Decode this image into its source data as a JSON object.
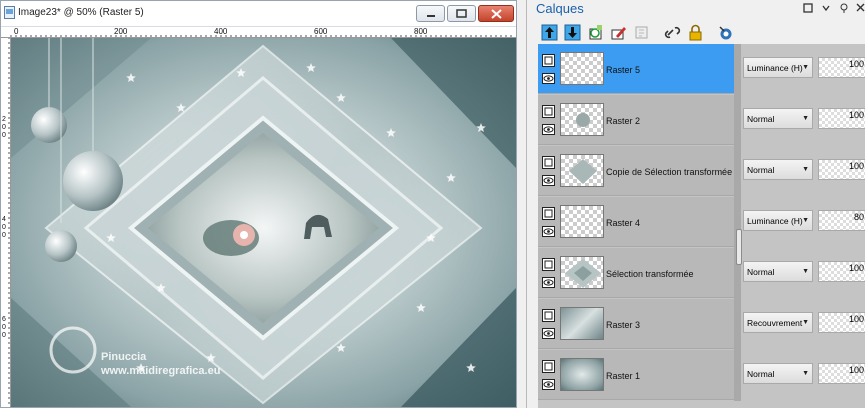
{
  "window": {
    "title": "Image23* @  50% (Raster 5)",
    "controls": {
      "minimize": "minimize",
      "maximize": "maximize",
      "close": "close"
    }
  },
  "ruler": {
    "top_labels": [
      "0",
      "200",
      "400",
      "600",
      "800"
    ],
    "left_labels": [
      "2",
      "0",
      "0",
      "4",
      "0",
      "0",
      "6",
      "0",
      "0"
    ]
  },
  "canvas": {
    "watermark_line1": "Pinuccia",
    "watermark_line2": "www.maidiregrafica.eu"
  },
  "panel": {
    "title": "Calques",
    "toolbar_icons": [
      "move-layer-up-icon",
      "move-layer-down-icon",
      "new-layer-icon",
      "edit-layer-icon",
      "properties-icon",
      "link-icon",
      "lock-icon",
      "mask-icon"
    ],
    "layers": [
      {
        "name": "Raster 5",
        "blend": "Luminance (H)",
        "opacity": "100",
        "selected": true
      },
      {
        "name": "Raster 2",
        "blend": "Normal",
        "opacity": "100",
        "selected": false
      },
      {
        "name": "Copie de Sélection transformée",
        "blend": "Normal",
        "opacity": "100",
        "selected": false
      },
      {
        "name": "Raster 4",
        "blend": "Luminance (H)",
        "opacity": "80",
        "selected": false
      },
      {
        "name": "Sélection transformée",
        "blend": "Normal",
        "opacity": "100",
        "selected": false
      },
      {
        "name": "Raster 3",
        "blend": "Recouvrement",
        "opacity": "100",
        "selected": false
      },
      {
        "name": "Raster 1",
        "blend": "Normal",
        "opacity": "100",
        "selected": false
      }
    ]
  },
  "colors": {
    "selection": "#3c9cf2",
    "title_blue": "#1b5fa8",
    "close_red": "#c4432b"
  }
}
